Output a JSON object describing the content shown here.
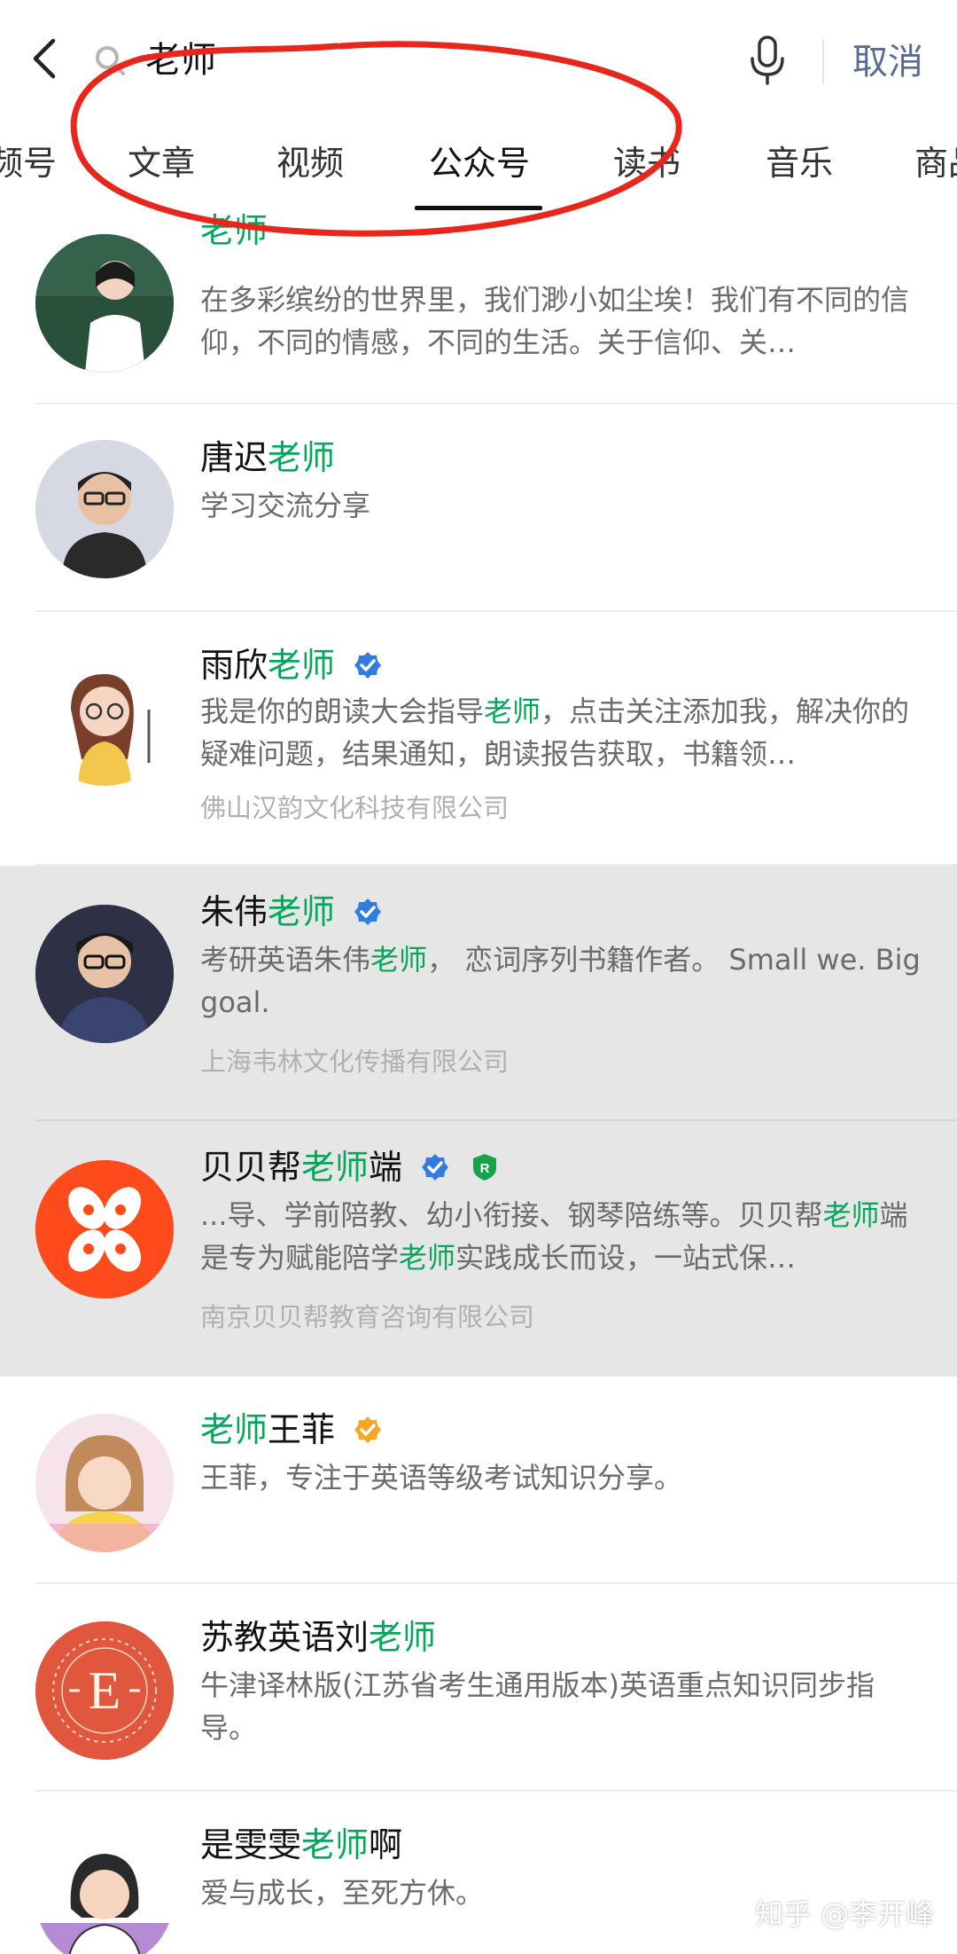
{
  "search": {
    "query": "老师",
    "cancel_label": "取消"
  },
  "tabs": [
    {
      "label": "频号"
    },
    {
      "label": "文章"
    },
    {
      "label": "视频"
    },
    {
      "label": "公众号"
    },
    {
      "label": "读书"
    },
    {
      "label": "音乐"
    },
    {
      "label": "商品"
    }
  ],
  "active_tab": "公众号",
  "results": [
    {
      "title_pre": "",
      "title_hit": "老师",
      "title_post": "",
      "badges": [],
      "desc": "在多彩缤纷的世界里，我们渺小如尘埃！我们有不同的信仰，不同的情感，不同的生活。关于信仰、关…"
    },
    {
      "title_pre": "唐迟",
      "title_hit": "老师",
      "title_post": "",
      "badges": [],
      "desc": "学习交流分享"
    },
    {
      "title_pre": "雨欣",
      "title_hit": "老师",
      "title_post": "",
      "badges": [
        "verified-blue"
      ],
      "desc_pre": "我是你的朗读大会指导",
      "desc_hit": "老师",
      "desc_post": "，点击关注添加我，解决你的疑难问题，结果通知，朗读报告获取，书籍领…",
      "company": "佛山汉韵文化科技有限公司"
    },
    {
      "title_pre": "朱伟",
      "title_hit": "老师",
      "title_post": "",
      "badges": [
        "verified-blue"
      ],
      "desc_pre": "考研英语朱伟",
      "desc_hit": "老师",
      "desc_post": "， 恋词序列书籍作者。 Small we. Big goal.",
      "company": "上海韦林文化传播有限公司",
      "highlighted": true
    },
    {
      "title_pre": "贝贝帮",
      "title_hit": "老师",
      "title_post": "端",
      "badges": [
        "verified-blue",
        "registered-green"
      ],
      "desc_pre": "...导、学前陪教、幼小衔接、钢琴陪练等。贝贝帮",
      "desc_hit": "老师",
      "desc_mid": "端是专为赋能陪学",
      "desc_hit2": "老师",
      "desc_post": "实践成长而设，一站式保…",
      "company": "南京贝贝帮教育咨询有限公司",
      "highlighted": true
    },
    {
      "title_pre": "",
      "title_hit": "老师",
      "title_post": "王菲",
      "badges": [
        "verified-orange"
      ],
      "desc": "王菲，专注于英语等级考试知识分享。"
    },
    {
      "title_pre": "苏教英语刘",
      "title_hit": "老师",
      "title_post": "",
      "badges": [],
      "desc": "牛津译林版(江苏省考生通用版本)英语重点知识同步指导。"
    },
    {
      "title_pre": "是雯雯",
      "title_hit": "老师",
      "title_post": "啊",
      "badges": [],
      "desc": "爱与成长，至死方休。"
    }
  ],
  "watermark": "知乎 @李开峰",
  "colors": {
    "hit": "#07a65a",
    "cancel": "#576b95",
    "highlight_bg": "#e6e6e6",
    "annotation": "#e8261c"
  }
}
